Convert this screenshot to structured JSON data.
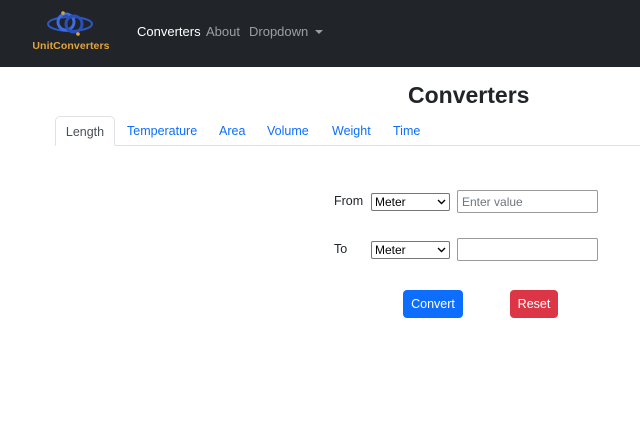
{
  "navbar": {
    "brand_name": "UnitConverters",
    "brand_icon": "unit-converter-logo",
    "links": [
      {
        "label": "Converters",
        "active": true
      },
      {
        "label": "About",
        "active": false
      },
      {
        "label": "Dropdown",
        "active": false
      }
    ]
  },
  "page": {
    "title": "Converters"
  },
  "tabs": [
    "Length",
    "Temperature",
    "Area",
    "Volume",
    "Weight",
    "Time"
  ],
  "form": {
    "from_label": "From",
    "from_unit": "Meter",
    "from_placeholder": "Enter value",
    "to_label": "To",
    "to_unit": "Meter",
    "to_value": ""
  },
  "buttons": {
    "convert": "Convert",
    "reset": "Reset"
  },
  "colors": {
    "navbar_bg": "#212529",
    "brand": "#e2a33c",
    "primary": "#0d6efd",
    "danger": "#dc3545",
    "tab_link": "#0d6efd"
  }
}
